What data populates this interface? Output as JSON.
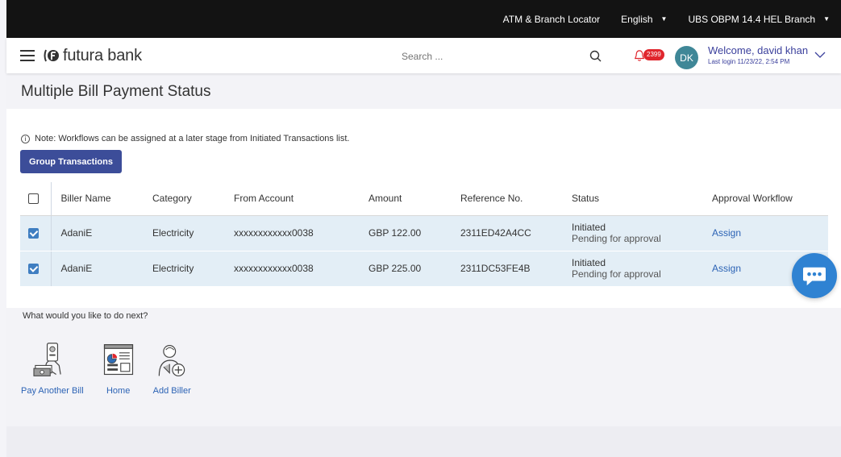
{
  "topbar": {
    "locator": "ATM & Branch Locator",
    "language": "English",
    "branch": "UBS OBPM 14.4 HEL Branch"
  },
  "header": {
    "brand": "futura bank",
    "search_placeholder": "Search ...",
    "notification_count": "2399",
    "avatar_initials": "DK",
    "welcome": "Welcome, david khan",
    "last_login": "Last login 11/23/22, 2:54 PM"
  },
  "page": {
    "title": "Multiple Bill Payment Status",
    "note_icon": "info-icon",
    "note": "Note: Workflows can be assigned at a later stage from Initiated Transactions list.",
    "group_button": "Group Transactions"
  },
  "table": {
    "headers": [
      "Biller Name",
      "Category",
      "From Account",
      "Amount",
      "Reference No.",
      "Status",
      "Approval Workflow"
    ],
    "rows": [
      {
        "checked": true,
        "biller": "AdaniE",
        "category": "Electricity",
        "account": "xxxxxxxxxxxx0038",
        "amount": "GBP 122.00",
        "reference": "2311ED42A4CC",
        "status": "Initiated",
        "status_detail": "Pending for approval",
        "action": "Assign"
      },
      {
        "checked": true,
        "biller": "AdaniE",
        "category": "Electricity",
        "account": "xxxxxxxxxxxx0038",
        "amount": "GBP 225.00",
        "reference": "2311DC53FE4B",
        "status": "Initiated",
        "status_detail": "Pending for approval",
        "action": "Assign"
      }
    ]
  },
  "next": {
    "title": "What would you like to do next?",
    "actions": [
      {
        "label": "Pay Another Bill",
        "icon": "pay-bill-icon"
      },
      {
        "label": "Home",
        "icon": "home-dashboard-icon"
      },
      {
        "label": "Add Biller",
        "icon": "add-biller-icon"
      }
    ]
  },
  "colors": {
    "topbar": "#131313",
    "primary_button": "#3c4d99",
    "link": "#2c63b5",
    "selected_row": "#e3eef6",
    "badge": "#e0262d",
    "avatar": "#3f8797",
    "chat": "#2f82d2"
  }
}
